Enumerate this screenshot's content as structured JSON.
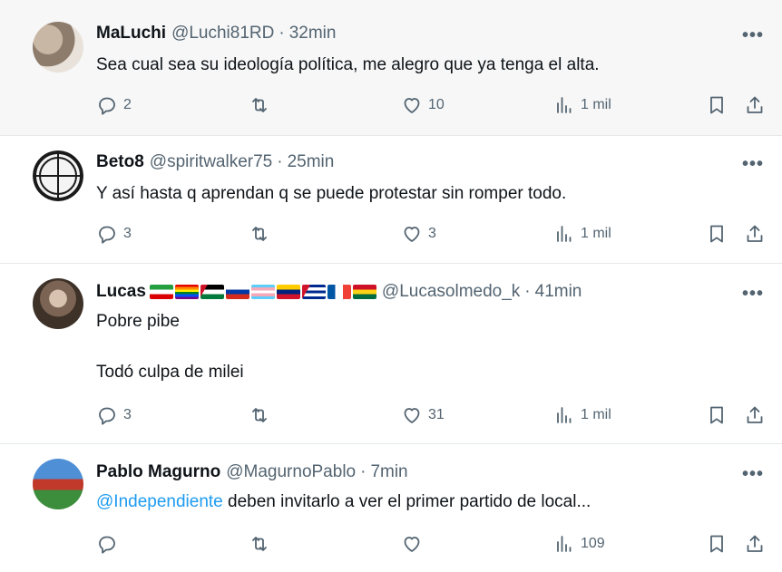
{
  "tweets": [
    {
      "name": "MaLuchi",
      "handle": "@Luchi81RD",
      "time": "32min",
      "text": "Sea cual sea su ideología política, me alegro que ya tenga el alta.",
      "replies": "2",
      "retweets": "",
      "likes": "10",
      "views": "1 mil"
    },
    {
      "name": "Beto8",
      "handle": "@spiritwalker75",
      "time": "25min",
      "text": "Y así hasta q aprendan q se puede protestar sin romper todo.",
      "replies": "3",
      "retweets": "",
      "likes": "3",
      "views": "1 mil"
    },
    {
      "name": "Lucas",
      "name_flags": [
        "flag-iran",
        "flag-rainbow",
        "flag-palestine",
        "flag-russia",
        "flag-trans",
        "flag-venezuela",
        "flag-cuba",
        "flag-france",
        "flag-ghana"
      ],
      "handle": "@Lucasolmedo_k",
      "time": "41min",
      "text_line1": "Pobre pibe",
      "text_line2": "Todó culpa de milei",
      "replies": "3",
      "retweets": "",
      "likes": "31",
      "views": "1 mil"
    },
    {
      "name": "Pablo Magurno",
      "handle": "@MagurnoPablo",
      "time": "7min",
      "mention": "@Independiente",
      "text": " deben invitarlo a ver el primer partido de local...",
      "replies": "",
      "retweets": "",
      "likes": "",
      "views": "109"
    }
  ],
  "separator": "·",
  "more_glyph": "•••",
  "icons": {
    "reply": "reply-icon",
    "retweet": "retweet-icon",
    "like": "heart-icon",
    "views": "views-icon",
    "bookmark": "bookmark-icon",
    "share": "share-icon",
    "more": "more-icon"
  },
  "colors": {
    "text": "#0f1419",
    "secondary": "#536471",
    "link": "#1d9bf0",
    "highlight_bg": "#f7f7f7",
    "divider": "#e6e9eb"
  }
}
